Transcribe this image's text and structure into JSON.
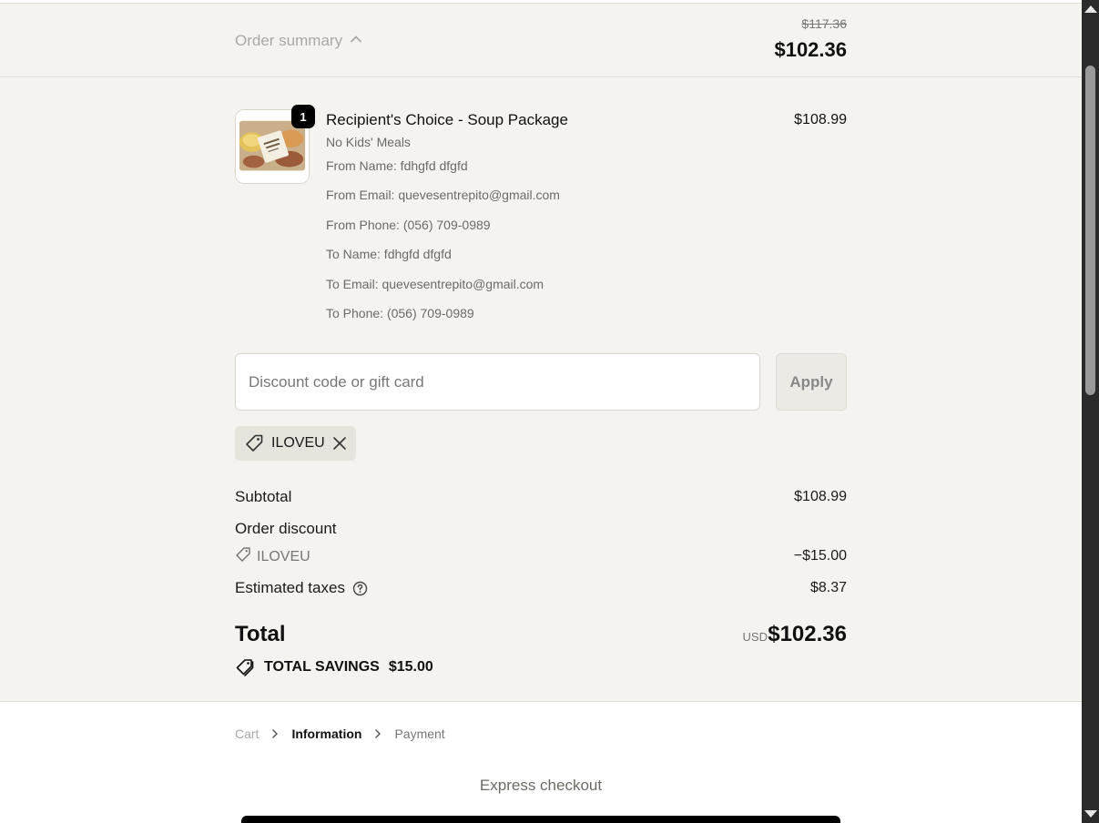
{
  "summary_bar": {
    "toggle_label": "Order summary",
    "toggle_icon": "chevron-up-icon",
    "original_price": "$117.36",
    "total_price": "$102.36"
  },
  "product": {
    "quantity": "1",
    "name": "Recipient's Choice - Soup Package",
    "variant": "No Kids' Meals",
    "price": "$108.99",
    "properties": [
      "From Name: fdhgfd dfgfd",
      "From Email: quevesentrepito@gmail.com",
      "From Phone: (056) 709-0989",
      "To Name: fdhgfd dfgfd",
      "To Email: quevesentrepito@gmail.com",
      "To Phone: (056) 709-0989"
    ]
  },
  "discount": {
    "placeholder": "Discount code or gift card",
    "value": "",
    "apply_label": "Apply",
    "applied_code": "ILOVEU"
  },
  "totals": {
    "subtotal_label": "Subtotal",
    "subtotal_value": "$108.99",
    "order_discount_label": "Order discount",
    "discount_code": "ILOVEU",
    "discount_value": "−$15.00",
    "taxes_label": "Estimated taxes",
    "taxes_value": "$8.37",
    "total_label": "Total",
    "currency": "USD",
    "total_value": "$102.36",
    "savings_label": "TOTAL SAVINGS",
    "savings_value": "$15.00"
  },
  "breadcrumb": {
    "cart": "Cart",
    "information": "Information",
    "payment": "Payment"
  },
  "express": {
    "title": "Express checkout"
  },
  "colors": {
    "panel_bg": "#f4f3ef",
    "border": "#dedbd3",
    "muted_text": "#6b6b66",
    "badge_bg": "#000000"
  }
}
